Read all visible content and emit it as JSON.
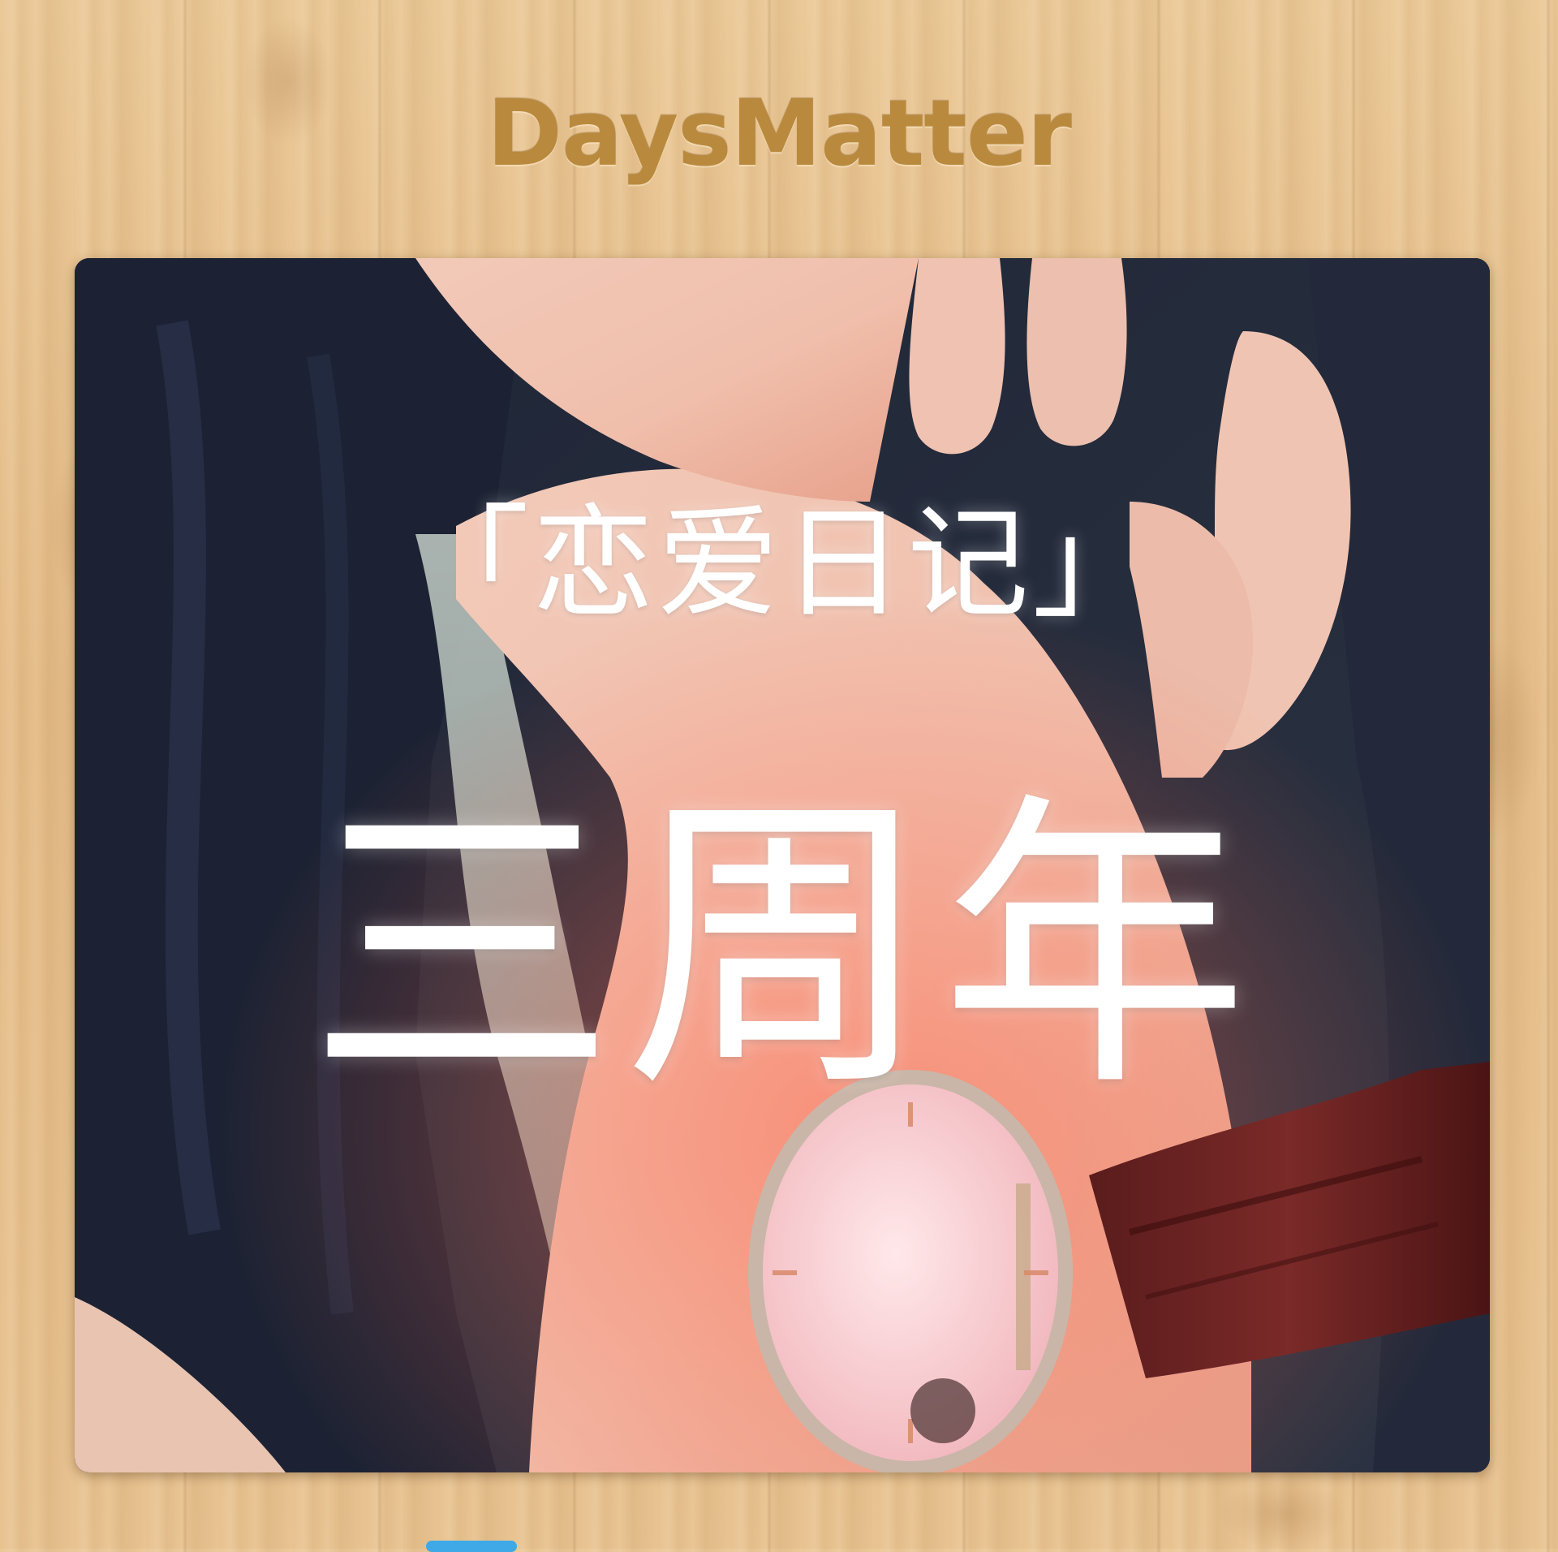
{
  "app": {
    "title": "DaysMatter"
  },
  "card": {
    "subtitle": "「恋爱日记」",
    "headline": "三周年",
    "photo": {
      "description_icon": "holding-hands-photo"
    }
  },
  "colors": {
    "title": "#b98a3e",
    "card_text": "#ffffff",
    "indicator": "#3fa9e8"
  }
}
